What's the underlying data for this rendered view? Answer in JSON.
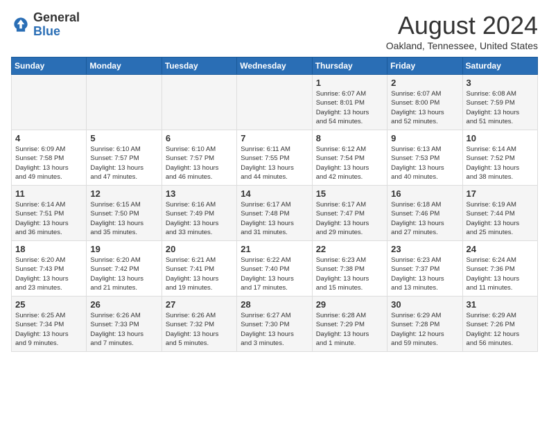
{
  "logo": {
    "general": "General",
    "blue": "Blue"
  },
  "title": "August 2024",
  "location": "Oakland, Tennessee, United States",
  "weekdays": [
    "Sunday",
    "Monday",
    "Tuesday",
    "Wednesday",
    "Thursday",
    "Friday",
    "Saturday"
  ],
  "weeks": [
    [
      {
        "day": "",
        "info": ""
      },
      {
        "day": "",
        "info": ""
      },
      {
        "day": "",
        "info": ""
      },
      {
        "day": "",
        "info": ""
      },
      {
        "day": "1",
        "info": "Sunrise: 6:07 AM\nSunset: 8:01 PM\nDaylight: 13 hours\nand 54 minutes."
      },
      {
        "day": "2",
        "info": "Sunrise: 6:07 AM\nSunset: 8:00 PM\nDaylight: 13 hours\nand 52 minutes."
      },
      {
        "day": "3",
        "info": "Sunrise: 6:08 AM\nSunset: 7:59 PM\nDaylight: 13 hours\nand 51 minutes."
      }
    ],
    [
      {
        "day": "4",
        "info": "Sunrise: 6:09 AM\nSunset: 7:58 PM\nDaylight: 13 hours\nand 49 minutes."
      },
      {
        "day": "5",
        "info": "Sunrise: 6:10 AM\nSunset: 7:57 PM\nDaylight: 13 hours\nand 47 minutes."
      },
      {
        "day": "6",
        "info": "Sunrise: 6:10 AM\nSunset: 7:57 PM\nDaylight: 13 hours\nand 46 minutes."
      },
      {
        "day": "7",
        "info": "Sunrise: 6:11 AM\nSunset: 7:55 PM\nDaylight: 13 hours\nand 44 minutes."
      },
      {
        "day": "8",
        "info": "Sunrise: 6:12 AM\nSunset: 7:54 PM\nDaylight: 13 hours\nand 42 minutes."
      },
      {
        "day": "9",
        "info": "Sunrise: 6:13 AM\nSunset: 7:53 PM\nDaylight: 13 hours\nand 40 minutes."
      },
      {
        "day": "10",
        "info": "Sunrise: 6:14 AM\nSunset: 7:52 PM\nDaylight: 13 hours\nand 38 minutes."
      }
    ],
    [
      {
        "day": "11",
        "info": "Sunrise: 6:14 AM\nSunset: 7:51 PM\nDaylight: 13 hours\nand 36 minutes."
      },
      {
        "day": "12",
        "info": "Sunrise: 6:15 AM\nSunset: 7:50 PM\nDaylight: 13 hours\nand 35 minutes."
      },
      {
        "day": "13",
        "info": "Sunrise: 6:16 AM\nSunset: 7:49 PM\nDaylight: 13 hours\nand 33 minutes."
      },
      {
        "day": "14",
        "info": "Sunrise: 6:17 AM\nSunset: 7:48 PM\nDaylight: 13 hours\nand 31 minutes."
      },
      {
        "day": "15",
        "info": "Sunrise: 6:17 AM\nSunset: 7:47 PM\nDaylight: 13 hours\nand 29 minutes."
      },
      {
        "day": "16",
        "info": "Sunrise: 6:18 AM\nSunset: 7:46 PM\nDaylight: 13 hours\nand 27 minutes."
      },
      {
        "day": "17",
        "info": "Sunrise: 6:19 AM\nSunset: 7:44 PM\nDaylight: 13 hours\nand 25 minutes."
      }
    ],
    [
      {
        "day": "18",
        "info": "Sunrise: 6:20 AM\nSunset: 7:43 PM\nDaylight: 13 hours\nand 23 minutes."
      },
      {
        "day": "19",
        "info": "Sunrise: 6:20 AM\nSunset: 7:42 PM\nDaylight: 13 hours\nand 21 minutes."
      },
      {
        "day": "20",
        "info": "Sunrise: 6:21 AM\nSunset: 7:41 PM\nDaylight: 13 hours\nand 19 minutes."
      },
      {
        "day": "21",
        "info": "Sunrise: 6:22 AM\nSunset: 7:40 PM\nDaylight: 13 hours\nand 17 minutes."
      },
      {
        "day": "22",
        "info": "Sunrise: 6:23 AM\nSunset: 7:38 PM\nDaylight: 13 hours\nand 15 minutes."
      },
      {
        "day": "23",
        "info": "Sunrise: 6:23 AM\nSunset: 7:37 PM\nDaylight: 13 hours\nand 13 minutes."
      },
      {
        "day": "24",
        "info": "Sunrise: 6:24 AM\nSunset: 7:36 PM\nDaylight: 13 hours\nand 11 minutes."
      }
    ],
    [
      {
        "day": "25",
        "info": "Sunrise: 6:25 AM\nSunset: 7:34 PM\nDaylight: 13 hours\nand 9 minutes."
      },
      {
        "day": "26",
        "info": "Sunrise: 6:26 AM\nSunset: 7:33 PM\nDaylight: 13 hours\nand 7 minutes."
      },
      {
        "day": "27",
        "info": "Sunrise: 6:26 AM\nSunset: 7:32 PM\nDaylight: 13 hours\nand 5 minutes."
      },
      {
        "day": "28",
        "info": "Sunrise: 6:27 AM\nSunset: 7:30 PM\nDaylight: 13 hours\nand 3 minutes."
      },
      {
        "day": "29",
        "info": "Sunrise: 6:28 AM\nSunset: 7:29 PM\nDaylight: 13 hours\nand 1 minute."
      },
      {
        "day": "30",
        "info": "Sunrise: 6:29 AM\nSunset: 7:28 PM\nDaylight: 12 hours\nand 59 minutes."
      },
      {
        "day": "31",
        "info": "Sunrise: 6:29 AM\nSunset: 7:26 PM\nDaylight: 12 hours\nand 56 minutes."
      }
    ]
  ]
}
